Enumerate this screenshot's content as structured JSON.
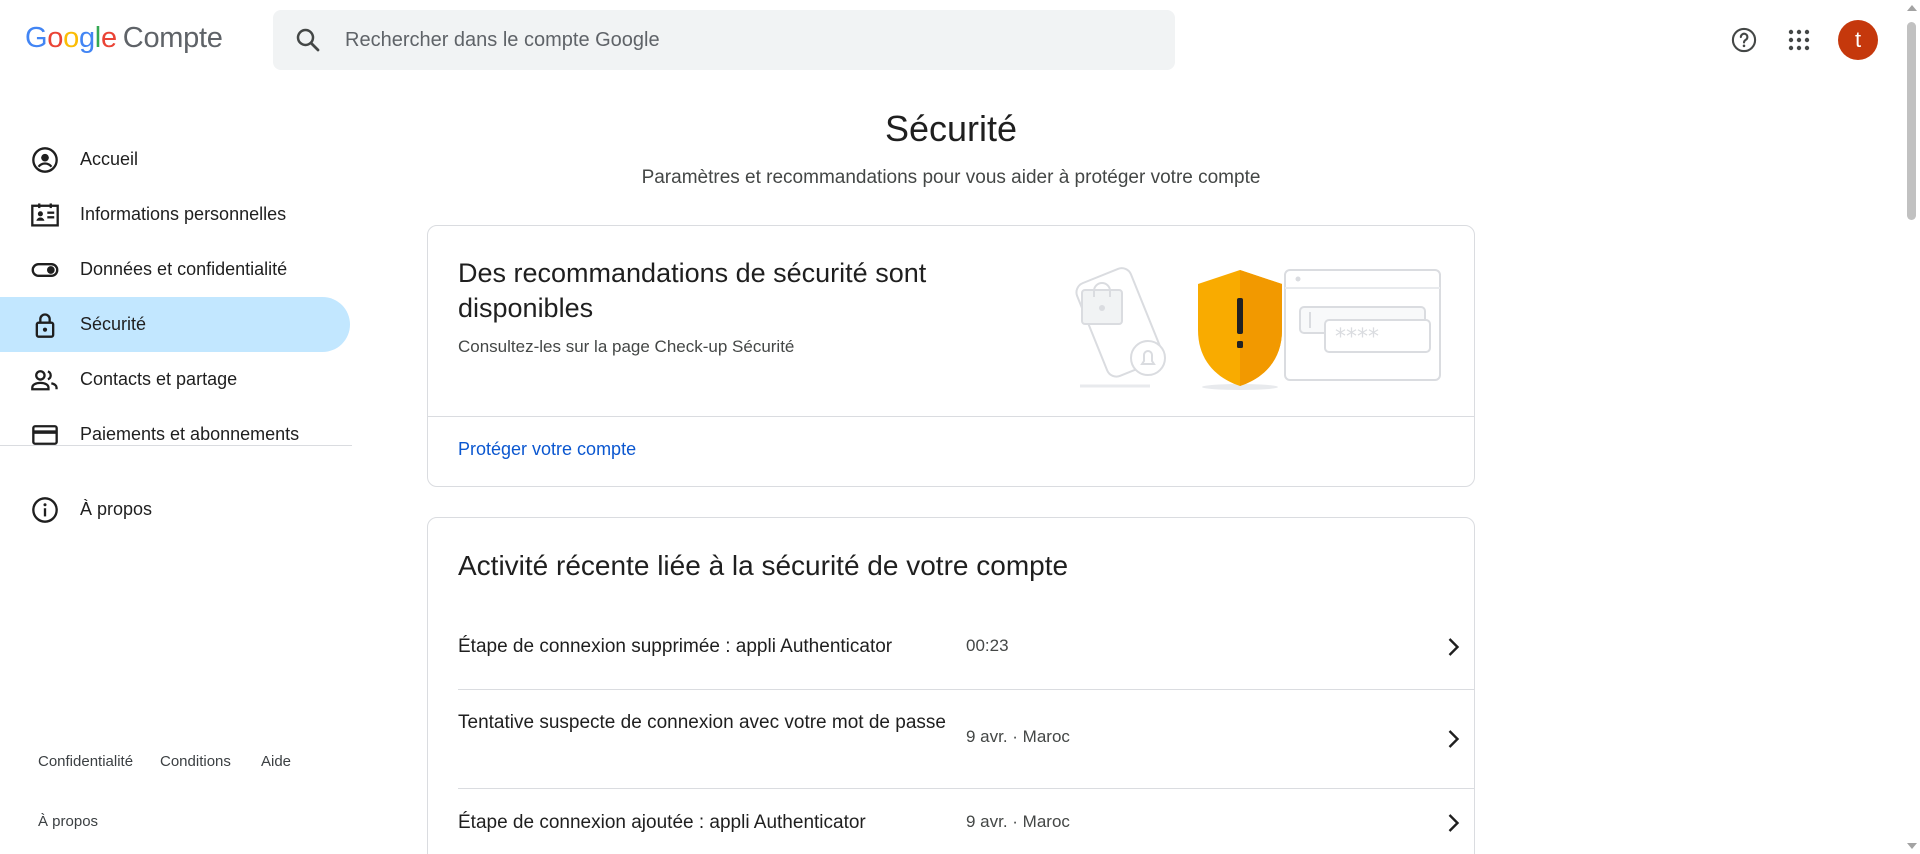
{
  "header": {
    "logo": {
      "g1": "G",
      "o1": "o",
      "o2": "o",
      "g2": "g",
      "l": "l",
      "e": "e",
      "product": "Compte"
    },
    "search_placeholder": "Rechercher dans le compte Google",
    "avatar_letter": "t",
    "avatar_color": "#c5380c"
  },
  "sidebar": {
    "items": [
      {
        "label": "Accueil",
        "icon": "account-circle-icon"
      },
      {
        "label": "Informations personnelles",
        "icon": "id-card-icon"
      },
      {
        "label": "Données et confidentialité",
        "icon": "toggle-icon"
      },
      {
        "label": "Sécurité",
        "icon": "lock-icon",
        "active": true
      },
      {
        "label": "Contacts et partage",
        "icon": "people-icon"
      },
      {
        "label": "Paiements et abonnements",
        "icon": "credit-card-icon"
      }
    ],
    "about": {
      "label": "À propos",
      "icon": "info-icon"
    },
    "footer": {
      "privacy": "Confidentialité",
      "terms": "Conditions",
      "help": "Aide",
      "about": "À propos"
    }
  },
  "main": {
    "title": "Sécurité",
    "subtitle": "Paramètres et recommandations pour vous aider à protéger votre compte",
    "recommendations": {
      "title": "Des recommandations de sécurité sont disponibles",
      "subtitle": "Consultez-les sur la page Check-up Sécurité",
      "link": "Protéger votre compte"
    },
    "activity": {
      "title": "Activité récente liée à la sécurité de votre compte",
      "rows": [
        {
          "event": "Étape de connexion supprimée : appli Authenticator",
          "meta": "00:23"
        },
        {
          "event": "Tentative suspecte de connexion avec votre mot de passe",
          "meta": "9 avr. · Maroc"
        },
        {
          "event": "Étape de connexion ajoutée : appli Authenticator",
          "meta": "9 avr. · Maroc"
        }
      ]
    }
  },
  "colors": {
    "accent_blue": "#0b57d0",
    "active_nav": "#c2e7ff",
    "shield": "#f9ab00"
  }
}
